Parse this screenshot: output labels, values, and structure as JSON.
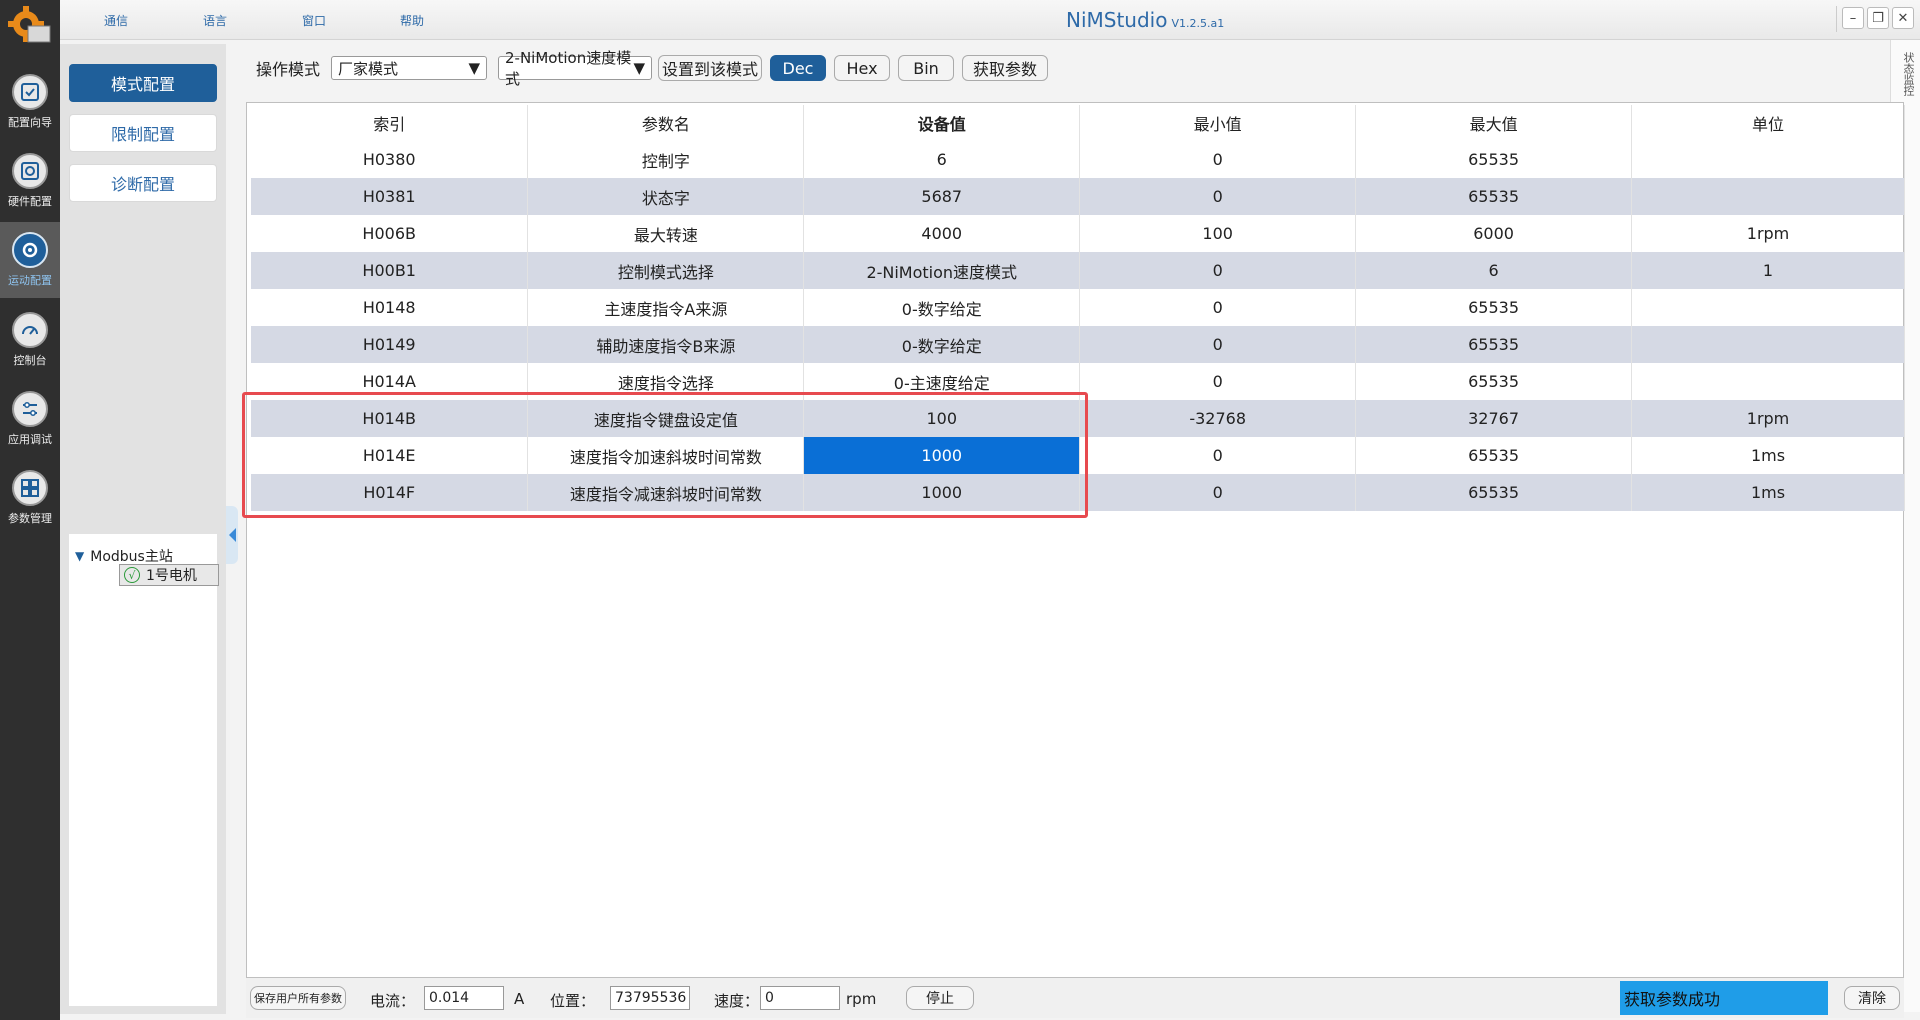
{
  "app": {
    "title": "NiMStudio",
    "version": "V1.2.5.a1"
  },
  "menu": [
    "通信",
    "语言",
    "窗口",
    "帮助"
  ],
  "window_buttons": {
    "minimize": "–",
    "restore": "❐",
    "close": "✕"
  },
  "leftnav": [
    {
      "label": "配置向导",
      "icon": "config-wizard-icon"
    },
    {
      "label": "硬件配置",
      "icon": "hardware-config-icon"
    },
    {
      "label": "运动配置",
      "icon": "motion-config-icon",
      "active": true
    },
    {
      "label": "控制台",
      "icon": "gauge-icon"
    },
    {
      "label": "应用调试",
      "icon": "sliders-icon"
    },
    {
      "label": "参数管理",
      "icon": "param-manage-icon"
    }
  ],
  "subnav": {
    "mode_config": "模式配置",
    "limit_config": "限制配置",
    "diag_config": "诊断配置"
  },
  "tree": {
    "root": "Modbus主站",
    "child": "1号电机",
    "child_check": "√",
    "caret": "▼"
  },
  "toolbar": {
    "mode_label": "操作模式",
    "mode_value": "厂家模式",
    "control_mode_value": "2-NiMotion速度模式",
    "set_mode_button": "设置到该模式",
    "dec": "Dec",
    "hex": "Hex",
    "bin": "Bin",
    "get_params": "获取参数",
    "arrow": "▼"
  },
  "status_monitor_tab": "状态监控",
  "table": {
    "headers": [
      "索引",
      "参数名",
      "设备值",
      "最小值",
      "最大值",
      "单位"
    ],
    "rows": [
      [
        "H0380",
        "控制字",
        "6",
        "0",
        "65535",
        ""
      ],
      [
        "H0381",
        "状态字",
        "5687",
        "0",
        "65535",
        ""
      ],
      [
        "H006B",
        "最大转速",
        "4000",
        "100",
        "6000",
        "1rpm"
      ],
      [
        "H00B1",
        "控制模式选择",
        "2-NiMotion速度模式",
        "0",
        "6",
        "1"
      ],
      [
        "H0148",
        "主速度指令A来源",
        "0-数字给定",
        "0",
        "65535",
        ""
      ],
      [
        "H0149",
        "辅助速度指令B来源",
        "0-数字给定",
        "0",
        "65535",
        ""
      ],
      [
        "H014A",
        "速度指令选择",
        "0-主速度给定",
        "0",
        "65535",
        ""
      ],
      [
        "H014B",
        "速度指令键盘设定值",
        "100",
        "-32768",
        "32767",
        "1rpm"
      ],
      [
        "H014E",
        "速度指令加速斜坡时间常数",
        "1000",
        "0",
        "65535",
        "1ms"
      ],
      [
        "H014F",
        "速度指令减速斜坡时间常数",
        "1000",
        "0",
        "65535",
        "1ms"
      ]
    ],
    "selected_row": 8
  },
  "statusbar": {
    "save_all": "保存用户所有参数",
    "current_label": "电流：",
    "current_value": "0.014",
    "current_unit": "A",
    "position_label": "位置：",
    "position_value": "73795536",
    "speed_label": "速度：",
    "speed_value": "0",
    "speed_unit": "rpm",
    "stop": "停止",
    "message": "获取参数成功",
    "clear": "清除"
  }
}
